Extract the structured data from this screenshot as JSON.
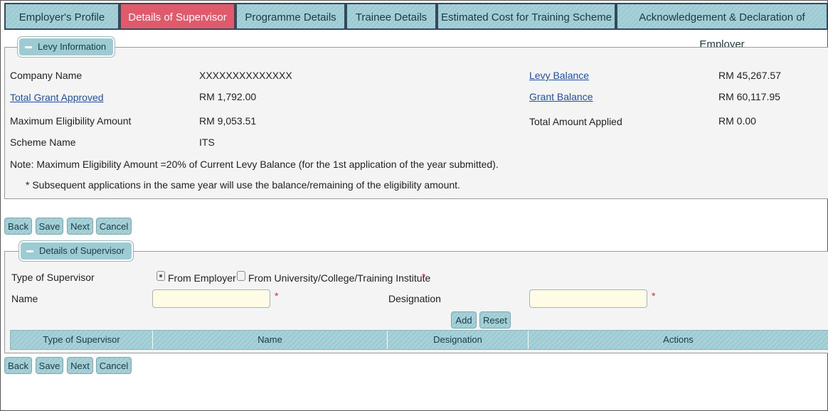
{
  "tabs": [
    {
      "label": "Employer's Profile"
    },
    {
      "label": "Details of Supervisor"
    },
    {
      "label": "Programme Details"
    },
    {
      "label": "Trainee Details"
    },
    {
      "label": "Estimated Cost for Training Scheme"
    },
    {
      "label": "Acknowledgement & Declaration of Employer"
    }
  ],
  "active_tab": "Details of Supervisor",
  "levy": {
    "legend": "Levy Information",
    "company_name_label": "Company Name",
    "company_name_value": "XXXXXXXXXXXXXX",
    "total_grant_label": "Total Grant Approved",
    "total_grant_value": "RM 1,792.00",
    "max_elig_label": "Maximum Eligibility Amount",
    "max_elig_value": "RM 9,053.51",
    "scheme_label": "Scheme Name",
    "scheme_value": "ITS",
    "levy_balance_label": "Levy Balance",
    "levy_balance_value": "RM 45,267.57",
    "grant_balance_label": "Grant Balance",
    "grant_balance_value": "RM 60,117.95",
    "total_applied_label": "Total Amount Applied",
    "total_applied_value": "RM 0.00",
    "note": "Note: Maximum Eligibility Amount =20% of Current Levy Balance (for the 1st application of the year submitted).",
    "subnote": "* Subsequent applications in the same year will use the balance/remaining of the eligibility amount."
  },
  "actions": {
    "back": "Back",
    "save": "Save",
    "next": "Next",
    "cancel": "Cancel"
  },
  "supervisor": {
    "legend": "Details of Supervisor",
    "type_label": "Type of Supervisor",
    "option_employer": "From Employer",
    "option_institute": "From University/College/Training Institute",
    "name_label": "Name",
    "name_value": "",
    "designation_label": "Designation",
    "designation_value": "",
    "required_mark": "*",
    "add": "Add",
    "reset": "Reset",
    "table_headers": [
      "Type of Supervisor",
      "Name",
      "Designation",
      "Actions"
    ]
  },
  "colors": {
    "tab": "#9ccbd3",
    "active_tab": "#e15a6c",
    "link": "#1f4fa8",
    "required": "#d9262e"
  }
}
